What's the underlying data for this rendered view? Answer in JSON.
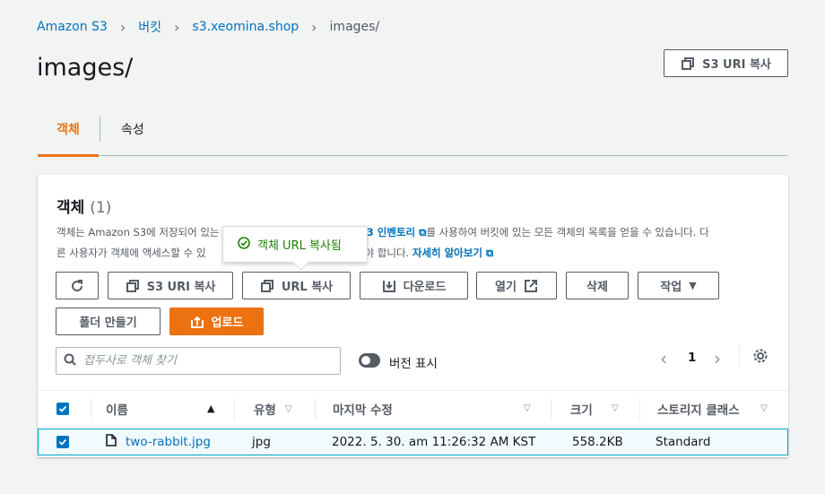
{
  "breadcrumb": {
    "items": [
      "Amazon S3",
      "버킷",
      "s3.xeomina.shop"
    ],
    "current": "images/"
  },
  "page": {
    "title": "images/",
    "copy_s3_uri_label": "S3 URI 복사"
  },
  "tabs": [
    {
      "label": "객체",
      "active": true
    },
    {
      "label": "속성",
      "active": false
    }
  ],
  "objects_panel": {
    "title": "객체",
    "count": "(1)",
    "description_line1_pre": "객체는 Amazon S3에 저장되어 있는",
    "inventory_link": "S3 인벤토리",
    "description_line1_post": "를 사용하여 버킷에 있는 모든 객체의 목록을 얻을 수 있습니다. 다",
    "description_line2_pre": "른 사용자가 객체에 액세스할 수 있",
    "description_line2_mid": "여해야 합니다.",
    "learn_more_link": "자세히 알아보기"
  },
  "tooltip": {
    "text": "객체 URL 복사됨"
  },
  "toolbar": {
    "refresh_label": "",
    "copy_s3_uri": "S3 URI 복사",
    "copy_url": "URL 복사",
    "download": "다운로드",
    "open": "열기",
    "delete": "삭제",
    "actions": "작업",
    "create_folder": "폴더 만들기",
    "upload": "업로드"
  },
  "search": {
    "placeholder": "접두사로 객체 찾기"
  },
  "version_toggle": {
    "label": "버전 표시",
    "on": false
  },
  "pagination": {
    "current_page": "1"
  },
  "table": {
    "columns": [
      "이름",
      "유형",
      "마지막 수정",
      "크기",
      "스토리지 클래스"
    ],
    "rows": [
      {
        "name": "two-rabbit.jpg",
        "type": "jpg",
        "last_modified": "2022. 5. 30. am 11:26:32 AM KST",
        "size": "558.2KB",
        "storage_class": "Standard",
        "selected": true
      }
    ]
  },
  "colors": {
    "accent": "#ec7211",
    "link": "#0073bb",
    "success": "#1d8102"
  }
}
